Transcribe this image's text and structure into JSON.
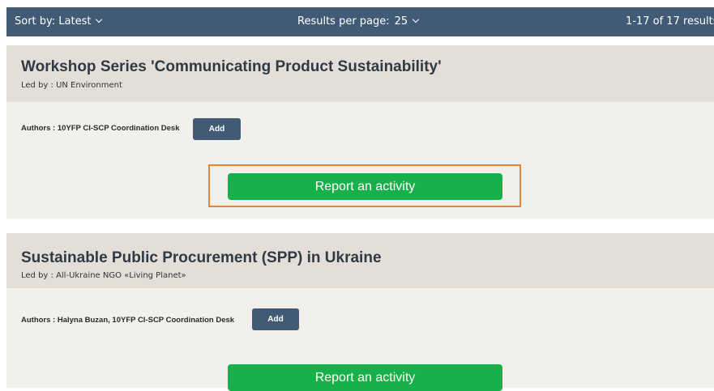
{
  "toolbar": {
    "sort_label": "Sort by: Latest",
    "per_page_label": "Results per page:",
    "per_page_value": "25",
    "results_count": "1-17 of 17 results"
  },
  "cards": [
    {
      "title": "Workshop Series 'Communicating Product Sustainability'",
      "led_by": "Led by : UN Environment",
      "authors": "Authors : 10YFP CI-SCP Coordination Desk",
      "add_label": "Add",
      "report_label": "Report an activity",
      "report_highlighted": true
    },
    {
      "title": "Sustainable Public Procurement (SPP) in Ukraine",
      "led_by": "Led by : All-Ukraine NGO «Living Planet»",
      "authors": "Authors : Halyna Buzan, 10YFP CI-SCP Coordination Desk",
      "add_label": "Add",
      "report_label": "Report an activity",
      "report_highlighted": false
    }
  ],
  "colors": {
    "toolbar_bg": "#415a76",
    "card_header_bg": "#e3dfd8",
    "card_body_bg": "#f2f0eb",
    "report_button": "#18b04a",
    "highlight_border": "#ed8331"
  },
  "icons": {
    "sort_dropdown": "chevron-down-icon",
    "per_page_dropdown": "chevron-down-icon"
  }
}
